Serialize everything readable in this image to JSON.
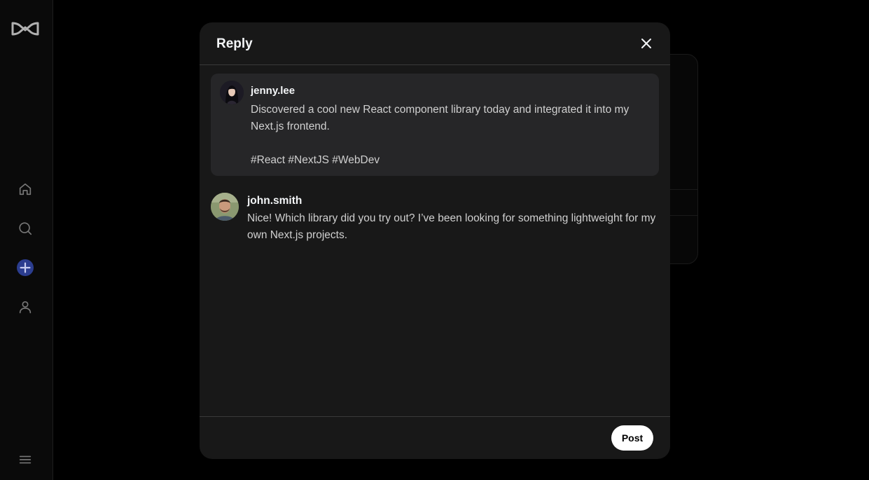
{
  "sidebar": {
    "logo": "threads-logo",
    "items": [
      {
        "icon": "home-icon"
      },
      {
        "icon": "search-icon"
      },
      {
        "icon": "plus-icon",
        "accent": "#2b3d8f"
      },
      {
        "icon": "user-icon"
      },
      {
        "icon": "menu-icon"
      }
    ]
  },
  "modal": {
    "title": "Reply",
    "close_icon": "close-icon",
    "original_post": {
      "username": "jenny.lee",
      "text": "Discovered a cool new React component library today and integrated it into my Next.js frontend.",
      "tags": "#React #NextJS #WebDev"
    },
    "reply": {
      "username": "john.smith",
      "text": "Nice! Which library did you try out? I’ve been looking for something lightweight for my own Next.js projects."
    },
    "post_label": "Post"
  },
  "colors": {
    "background": "#000000",
    "modal": "#181818",
    "quoted_post": "#262628",
    "accent": "#2b3d8f"
  }
}
